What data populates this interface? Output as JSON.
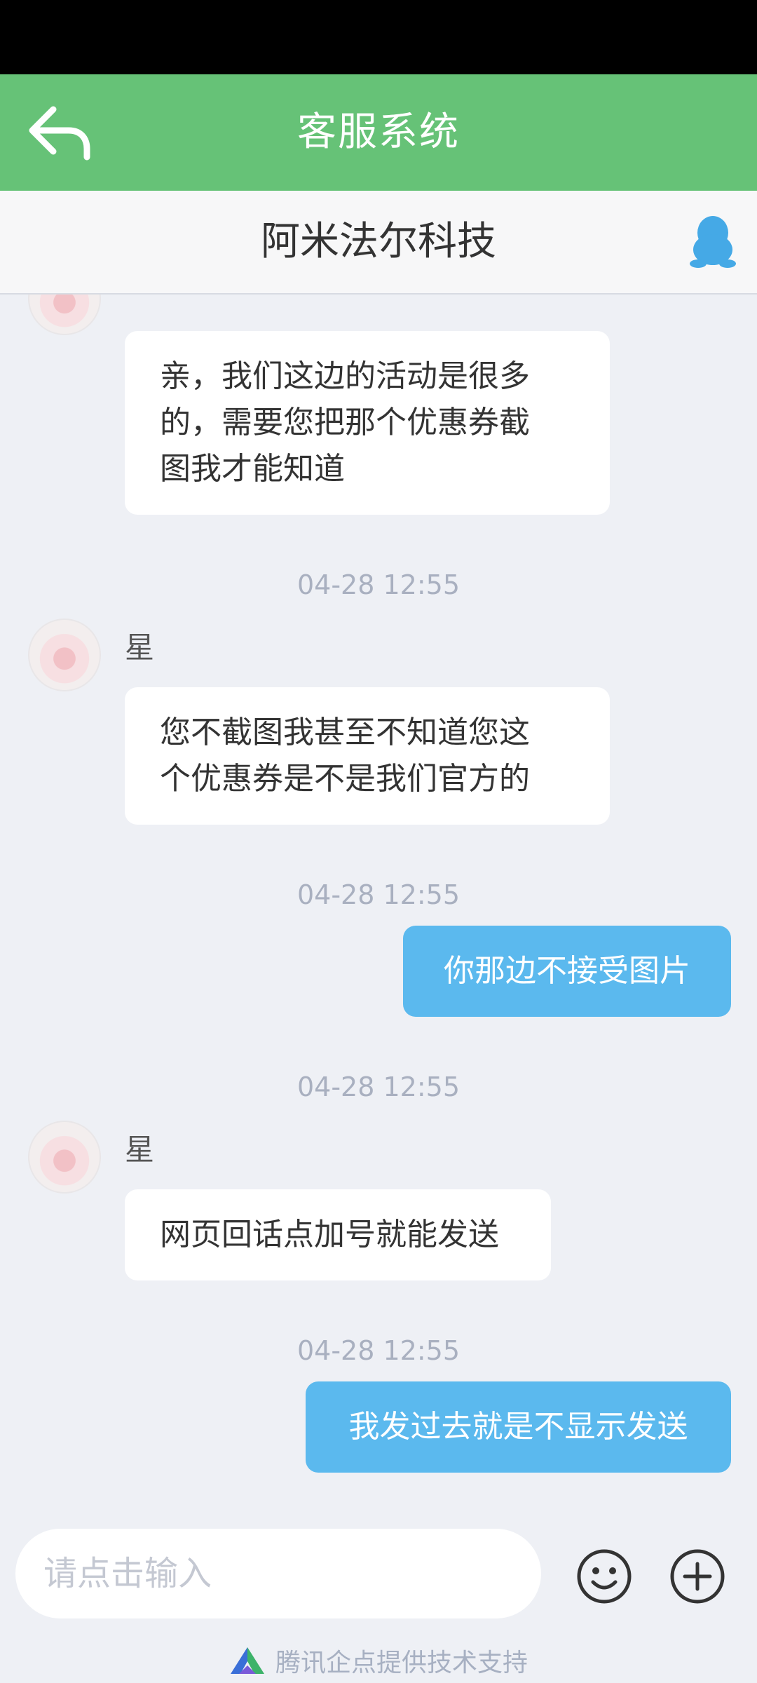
{
  "header": {
    "title": "客服系统",
    "back_icon": "reply-arrow-icon"
  },
  "subheader": {
    "title": "阿米法尔科技",
    "qq_icon": "qq-penguin-icon"
  },
  "colors": {
    "topbar": "#66c277",
    "my_bubble": "#5bb9ee",
    "background": "#eef0f5"
  },
  "messages": [
    {
      "sender": "",
      "text_lines": [
        "亲，我们这边的活动是很多",
        "的，需要您把那个优惠券截",
        "图我才能知道"
      ]
    },
    {
      "timestamp": "04-28 12:55"
    },
    {
      "sender": "星",
      "text_lines": [
        "您不截图我甚至不知道您这",
        "个优惠券是不是我们官方的"
      ]
    },
    {
      "timestamp": "04-28 12:55"
    },
    {
      "me": true,
      "text": "你那边不接受图片"
    },
    {
      "timestamp": "04-28 12:55"
    },
    {
      "sender": "星",
      "text": "网页回话点加号就能发送"
    },
    {
      "timestamp": "04-28 12:55"
    },
    {
      "me": true,
      "text": "我发过去就是不显示发送"
    }
  ],
  "input": {
    "placeholder": "请点击输入",
    "value": ""
  },
  "footer": {
    "text": "腾讯企点提供技术支持"
  }
}
